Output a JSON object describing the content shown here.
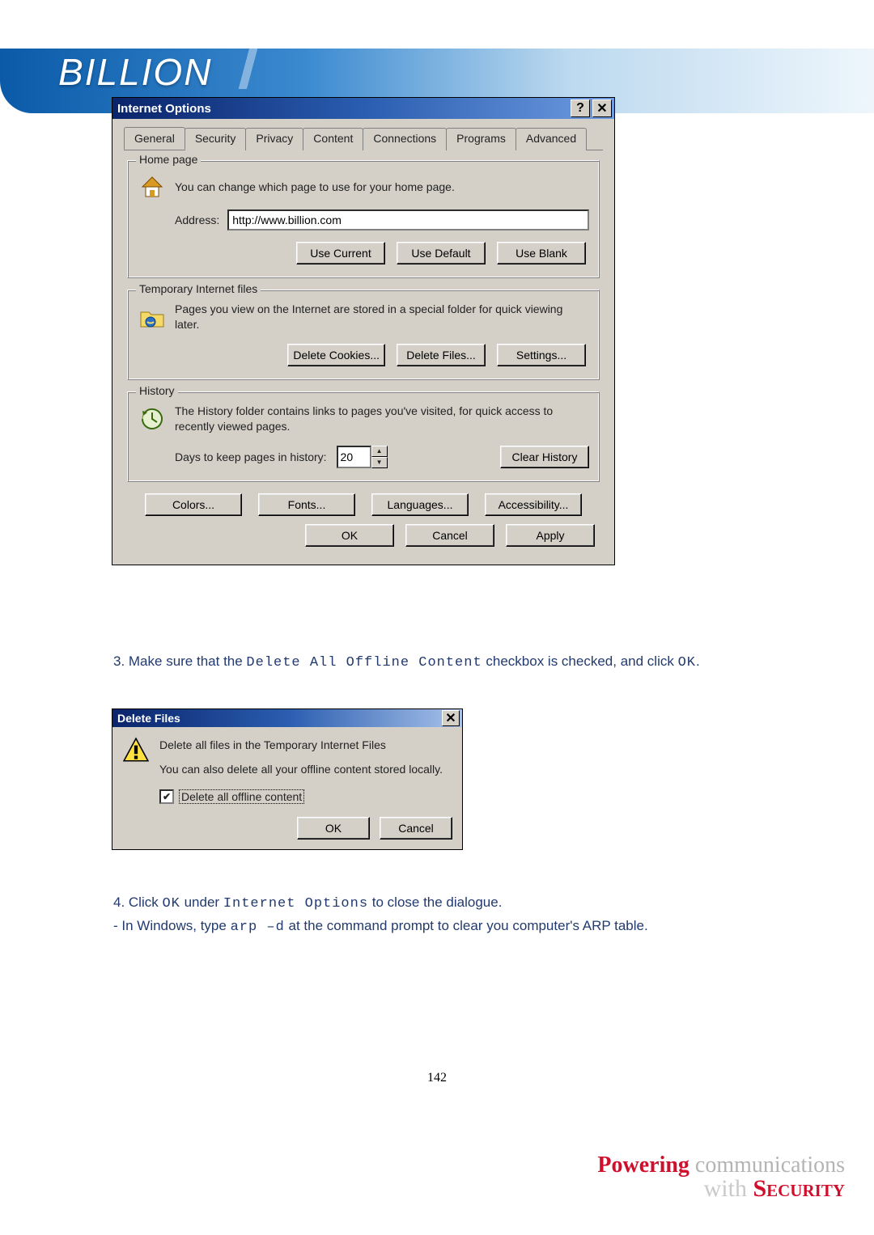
{
  "brand": {
    "logo_text": "BILLION"
  },
  "internet_options": {
    "title": "Internet Options",
    "tabs": [
      "General",
      "Security",
      "Privacy",
      "Content",
      "Connections",
      "Programs",
      "Advanced"
    ],
    "active_tab_index": 0,
    "homepage": {
      "legend": "Home page",
      "desc": "You can change which page to use for your home page.",
      "address_label": "Address:",
      "address_value": "http://www.billion.com",
      "btn_current": "Use Current",
      "btn_default": "Use Default",
      "btn_blank": "Use Blank"
    },
    "tempfiles": {
      "legend": "Temporary Internet files",
      "desc": "Pages you view on the Internet are stored in a special folder for quick viewing later.",
      "btn_cookies": "Delete Cookies...",
      "btn_files": "Delete Files...",
      "btn_settings": "Settings..."
    },
    "history": {
      "legend": "History",
      "desc": "The History folder contains links to pages you've visited, for quick access to recently viewed pages.",
      "days_label": "Days to keep pages in history:",
      "days_value": "20",
      "btn_clear": "Clear History"
    },
    "quad": {
      "colors": "Colors...",
      "fonts": "Fonts...",
      "languages": "Languages...",
      "accessibility": "Accessibility..."
    },
    "dialog_buttons": {
      "ok": "OK",
      "cancel": "Cancel",
      "apply": "Apply"
    }
  },
  "doc": {
    "step3_prefix": "3. Make sure that the ",
    "step3_mono": "Delete All Offline Content",
    "step3_mid": " checkbox is checked, and click ",
    "step3_ok": "OK",
    "step3_end": ".",
    "step4_a_prefix": "4. Click ",
    "step4_a_ok": "OK",
    "step4_a_mid": " under ",
    "step4_a_mono": "Internet Options",
    "step4_a_end": " to close the dialogue.",
    "step4_b_prefix": "- In Windows, type ",
    "step4_b_mono": "arp –d",
    "step4_b_end": " at the command prompt to clear you computer's ARP table.",
    "page_number": "142"
  },
  "delete_files": {
    "title": "Delete Files",
    "line1": "Delete all files in the Temporary Internet Files",
    "line2": "You can also delete all your offline content stored locally.",
    "checkbox_label": "Delete all offline content",
    "checked": true,
    "ok": "OK",
    "cancel": "Cancel"
  },
  "footer": {
    "l1_bold": "Powering",
    "l1_rest": " communications",
    "l2_prefix": "with ",
    "l2_bold": "Security"
  }
}
